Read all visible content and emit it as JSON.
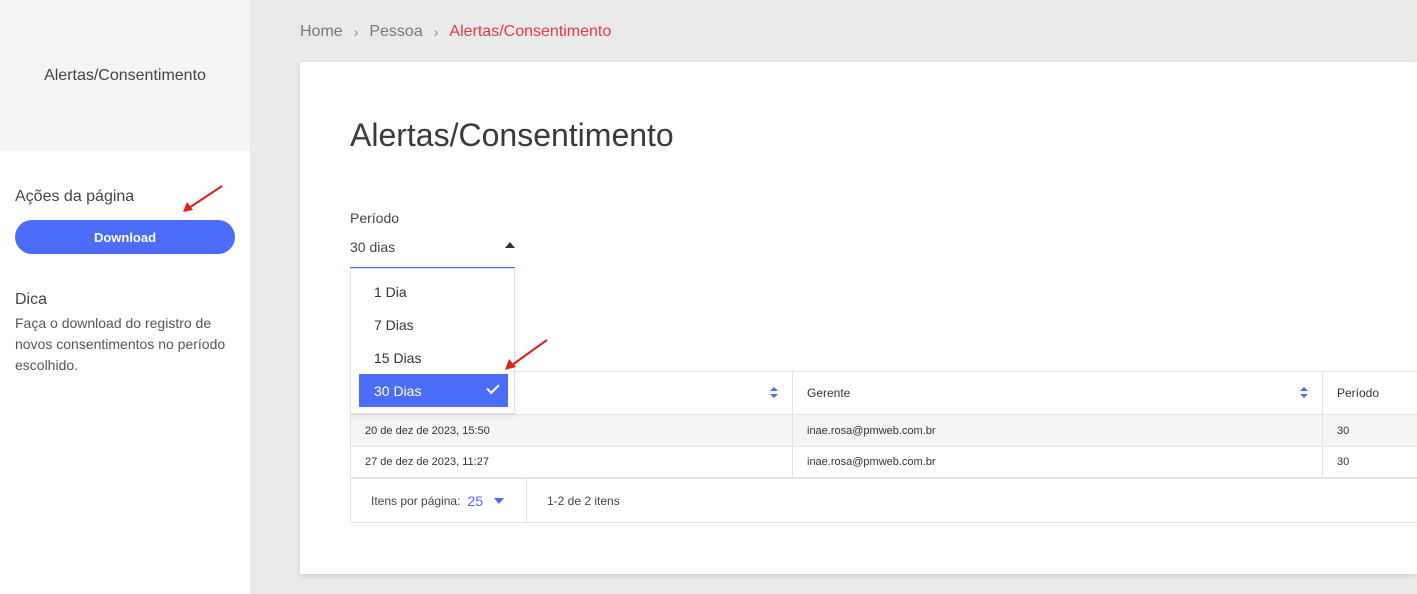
{
  "sidebar": {
    "title": "Alertas/Consentimento",
    "actions_title": "Ações da página",
    "download_label": "Download",
    "tip_title": "Dica",
    "tip_text": "Faça o download do registro de novos consentimentos no período escolhido."
  },
  "breadcrumb": [
    "Home",
    "Pessoa",
    "Alertas/Consentimento"
  ],
  "page": {
    "title": "Alertas/Consentimento",
    "period_label": "Período",
    "period_value": "30 dias"
  },
  "dropdown": {
    "options": [
      "1 Dia",
      "7 Dias",
      "15 Dias",
      "30 Dias"
    ],
    "selected": "30 Dias"
  },
  "table": {
    "columns": [
      "",
      "Gerente",
      "Período"
    ],
    "rows": [
      [
        "20 de dez de 2023, 15:50",
        "inae.rosa@pmweb.com.br",
        "30"
      ],
      [
        "27 de dez de 2023, 11:27",
        "inae.rosa@pmweb.com.br",
        "30"
      ]
    ]
  },
  "pagination": {
    "items_per_page_label": "Itens por página:",
    "items_per_page": "25",
    "range": "1-2 de 2 itens"
  },
  "colors": {
    "accent": "#4a6cf7",
    "breadcrumb_active": "#e53946",
    "annotation_arrow": "#e0201c"
  }
}
